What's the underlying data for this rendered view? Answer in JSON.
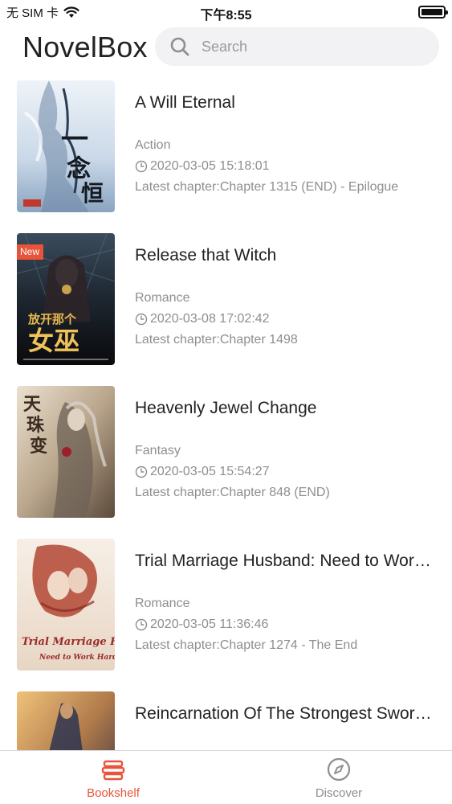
{
  "status_bar": {
    "carrier": "无 SIM 卡",
    "time": "下午8:55"
  },
  "header": {
    "app_title": "NovelBox",
    "search_placeholder": "Search"
  },
  "books": [
    {
      "title": "A Will Eternal",
      "genre": "Action",
      "updated": "2020-03-05 15:18:01",
      "latest_chapter": "Latest chapter:Chapter 1315 (END) - Epilogue",
      "is_new": false,
      "cover_colors": [
        "#dfe8f2",
        "#4a6a8e"
      ]
    },
    {
      "title": "Release that Witch",
      "genre": "Romance",
      "updated": "2020-03-08 17:02:42",
      "latest_chapter": "Latest chapter:Chapter 1498",
      "is_new": true,
      "new_label": "New",
      "cover_colors": [
        "#1e2a36",
        "#0e0e12"
      ]
    },
    {
      "title": "Heavenly Jewel Change",
      "genre": "Fantasy",
      "updated": "2020-03-05 15:54:27",
      "latest_chapter": "Latest chapter:Chapter 848 (END)",
      "is_new": false,
      "cover_colors": [
        "#d8c8b2",
        "#6d5a4a"
      ]
    },
    {
      "title": "Trial Marriage Husband: Need to Work Hard",
      "genre": "Romance",
      "updated": "2020-03-05 11:36:46",
      "latest_chapter": "Latest chapter:Chapter 1274 - The End",
      "is_new": false,
      "cover_colors": [
        "#f3e9df",
        "#c26a55"
      ]
    },
    {
      "title": "Reincarnation Of The Strongest Sword God",
      "genre": "",
      "updated": "",
      "latest_chapter": "",
      "is_new": false,
      "cover_colors": [
        "#e8b36a",
        "#2a2f4a"
      ]
    }
  ],
  "tab_bar": {
    "tabs": [
      {
        "label": "Bookshelf",
        "icon": "bookshelf-icon",
        "active": true
      },
      {
        "label": "Discover",
        "icon": "compass-icon",
        "active": false
      }
    ],
    "active_color": "#e8543a",
    "inactive_color": "#8e8e93"
  }
}
